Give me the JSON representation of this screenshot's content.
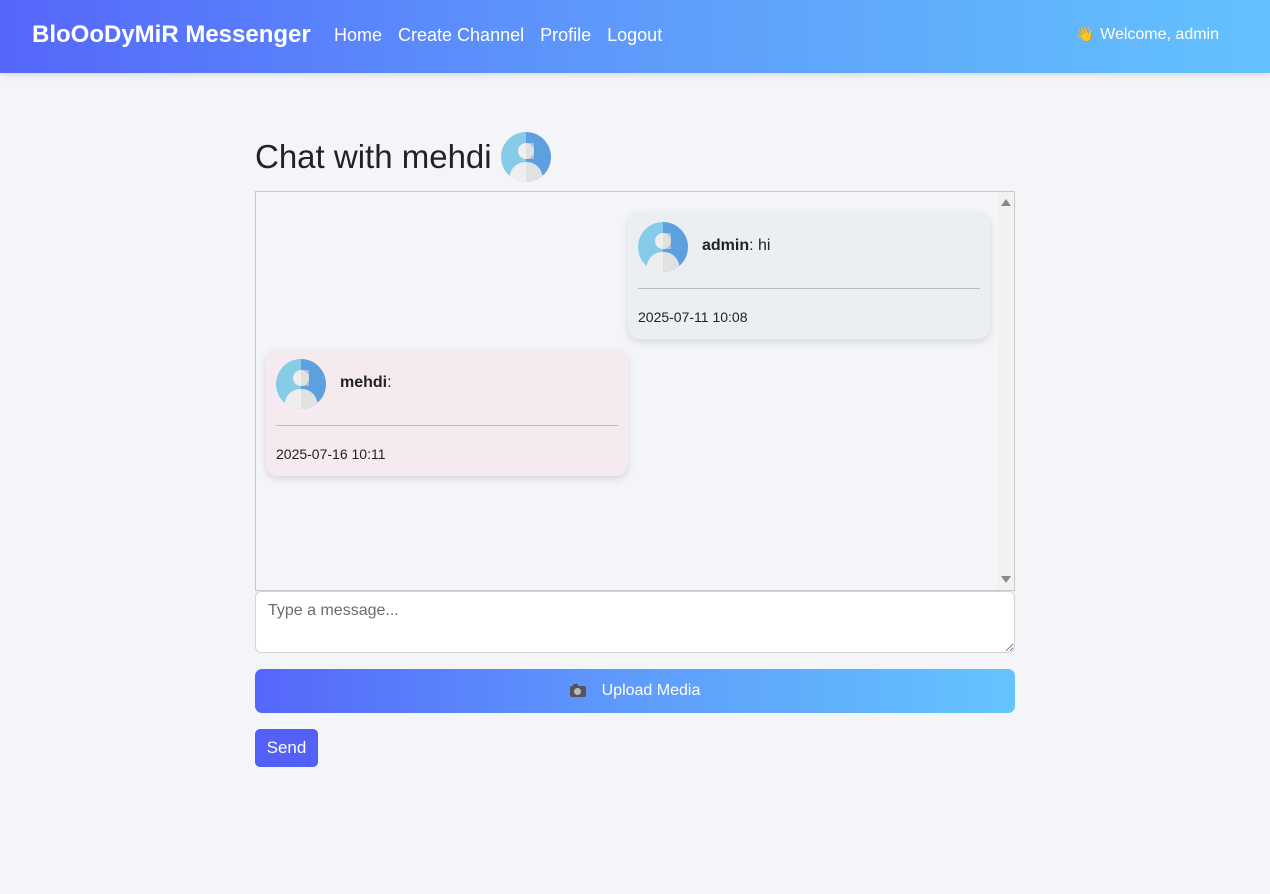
{
  "navbar": {
    "brand": "BloOoDyMiR Messenger",
    "links": [
      "Home",
      "Create Channel",
      "Profile",
      "Logout"
    ],
    "welcome_icon": "👋",
    "welcome_text": "Welcome, admin"
  },
  "chat": {
    "title": "Chat with mehdi",
    "messages": [
      {
        "sender": "admin",
        "separator": ": ",
        "text": "hi",
        "time": "2025-07-11 10:08",
        "direction": "sent"
      },
      {
        "sender": "mehdi",
        "separator": ":",
        "text": "",
        "time": "2025-07-16 10:11",
        "direction": "received"
      }
    ]
  },
  "composer": {
    "placeholder": "Type a message...",
    "upload_icon": "camera-icon",
    "upload_label": "Upload Media",
    "send_label": "Send"
  },
  "colors": {
    "navbar_gradient_start": "#5567fb",
    "navbar_gradient_end": "#63c2fd",
    "send_button": "#5461f7",
    "sent_bubble": "#ebeff1",
    "received_bubble": "#f5eaef",
    "page_background": "#f4f5f9"
  }
}
